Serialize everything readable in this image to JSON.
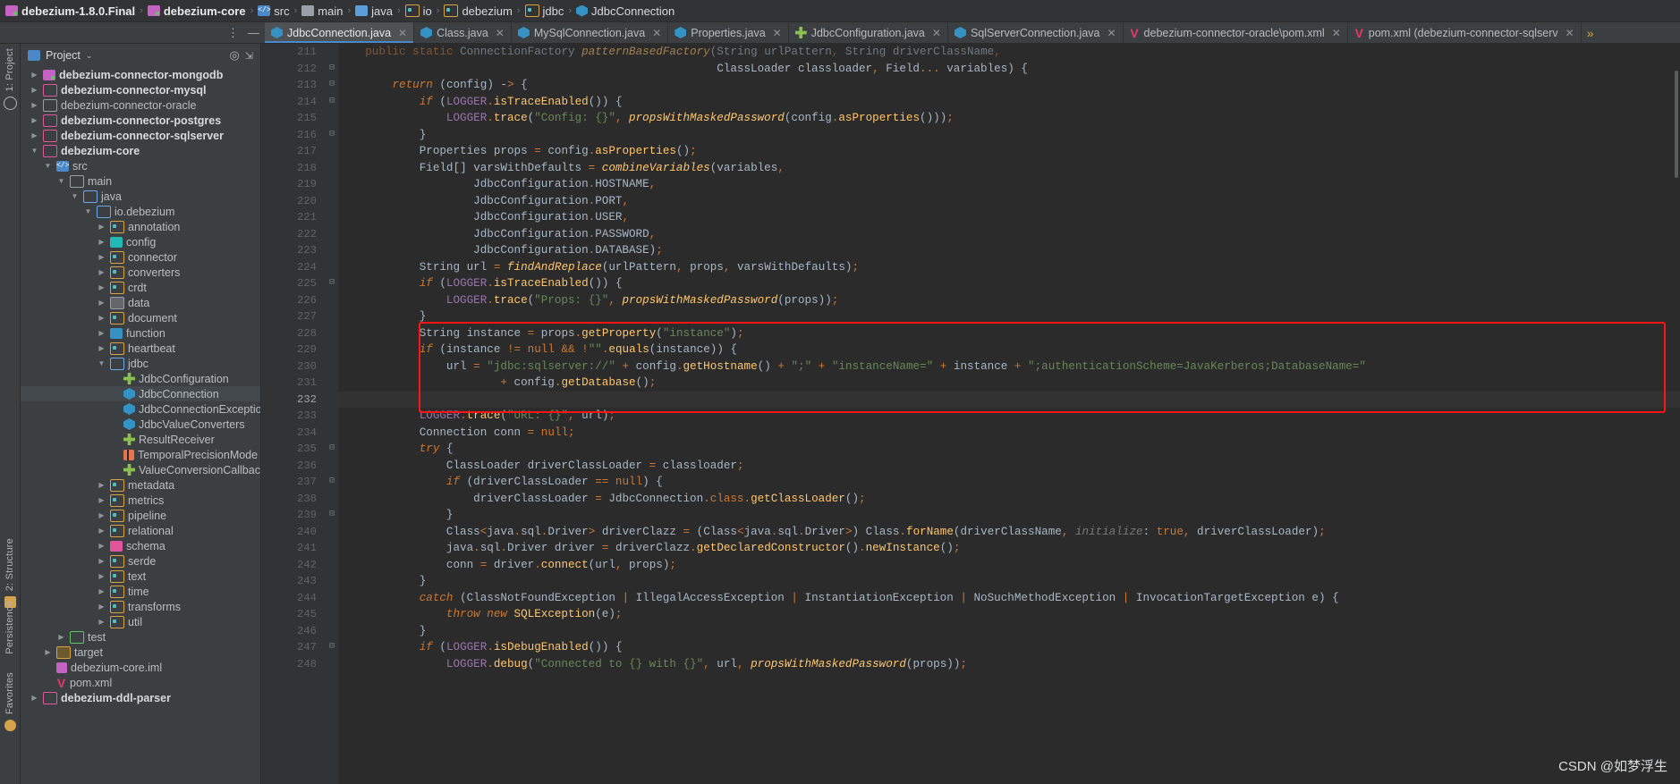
{
  "window": {
    "breadcrumb": [
      {
        "label": "debezium-1.8.0.Final",
        "icon": "module-icon",
        "bold": true
      },
      {
        "label": "debezium-core",
        "icon": "module-icon",
        "bold": true
      },
      {
        "label": "src",
        "icon": "source-root-icon",
        "bold": false
      },
      {
        "label": "main",
        "icon": "folder-grey-icon",
        "bold": false
      },
      {
        "label": "java",
        "icon": "folder-blue-icon",
        "bold": false
      },
      {
        "label": "io",
        "icon": "package-icon",
        "bold": false
      },
      {
        "label": "debezium",
        "icon": "package-icon",
        "bold": false
      },
      {
        "label": "jdbc",
        "icon": "package-icon",
        "bold": false
      },
      {
        "label": "JdbcConnection",
        "icon": "java-class-icon",
        "bold": false
      }
    ]
  },
  "tabs": {
    "items": [
      {
        "label": "JdbcConnection.java",
        "icon": "java-class-icon",
        "active": true,
        "closable": true
      },
      {
        "label": "Class.java",
        "icon": "java-class-icon",
        "active": false,
        "closable": true
      },
      {
        "label": "MySqlConnection.java",
        "icon": "java-class-icon",
        "active": false,
        "closable": true
      },
      {
        "label": "Properties.java",
        "icon": "java-class-icon",
        "active": false,
        "closable": true
      },
      {
        "label": "JdbcConfiguration.java",
        "icon": "java-interface-icon",
        "active": false,
        "closable": true
      },
      {
        "label": "SqlServerConnection.java",
        "icon": "java-class-icon",
        "active": false,
        "closable": true
      },
      {
        "label": "debezium-connector-oracle\\pom.xml",
        "icon": "maven-icon",
        "active": false,
        "closable": true
      },
      {
        "label": "pom.xml (debezium-connector-sqlserv",
        "icon": "maven-icon",
        "active": false,
        "closable": true
      }
    ],
    "overflow_label": "»",
    "menu_label": "⋮",
    "hide_label": "—"
  },
  "left_strip": {
    "items": [
      {
        "label": "1: Project",
        "icon": "project-icon"
      },
      {
        "label": "2: Structure",
        "icon": "structure-icon"
      },
      {
        "label": "Persistence",
        "icon": "persistence-icon"
      },
      {
        "label": "Favorites",
        "icon": "favorites-icon"
      }
    ]
  },
  "project_panel": {
    "title": "Project",
    "chevron": "⌄",
    "locate_icon": "target-icon",
    "collapse_icon": "collapse-all-icon",
    "tree": [
      {
        "label": "debezium-connector-mongodb",
        "depth": 1,
        "arrow": "collapsed",
        "icon": "module-icon",
        "bold": true,
        "selected": false
      },
      {
        "label": "debezium-connector-mysql",
        "depth": 1,
        "arrow": "collapsed",
        "icon": "folder-pink-icon",
        "bold": true,
        "selected": false
      },
      {
        "label": "debezium-connector-oracle",
        "depth": 1,
        "arrow": "collapsed",
        "icon": "folder-grey-icon",
        "bold": false,
        "selected": false
      },
      {
        "label": "debezium-connector-postgres",
        "depth": 1,
        "arrow": "collapsed",
        "icon": "folder-pink-icon",
        "bold": true,
        "selected": false
      },
      {
        "label": "debezium-connector-sqlserver",
        "depth": 1,
        "arrow": "collapsed",
        "icon": "folder-pink-icon",
        "bold": true,
        "selected": false
      },
      {
        "label": "debezium-core",
        "depth": 1,
        "arrow": "expanded",
        "icon": "folder-pink-icon",
        "bold": true,
        "selected": false
      },
      {
        "label": "src",
        "depth": 2,
        "arrow": "expanded",
        "icon": "source-root-icon",
        "bold": false,
        "selected": false
      },
      {
        "label": "main",
        "depth": 3,
        "arrow": "expanded",
        "icon": "folder-grey-icon",
        "bold": false,
        "selected": false
      },
      {
        "label": "java",
        "depth": 4,
        "arrow": "expanded",
        "icon": "folder-blue-icon",
        "bold": false,
        "selected": false
      },
      {
        "label": "io.debezium",
        "depth": 5,
        "arrow": "expanded",
        "icon": "folder-blue-icon",
        "bold": false,
        "selected": false
      },
      {
        "label": "annotation",
        "depth": 6,
        "arrow": "collapsed",
        "icon": "package-icon",
        "bold": false,
        "selected": false
      },
      {
        "label": "config",
        "depth": 6,
        "arrow": "collapsed",
        "icon": "package-config-icon",
        "bold": false,
        "selected": false
      },
      {
        "label": "connector",
        "depth": 6,
        "arrow": "collapsed",
        "icon": "package-icon",
        "bold": false,
        "selected": false
      },
      {
        "label": "converters",
        "depth": 6,
        "arrow": "collapsed",
        "icon": "package-icon",
        "bold": false,
        "selected": false
      },
      {
        "label": "crdt",
        "depth": 6,
        "arrow": "collapsed",
        "icon": "package-icon",
        "bold": false,
        "selected": false
      },
      {
        "label": "data",
        "depth": 6,
        "arrow": "collapsed",
        "icon": "package-grey-icon",
        "bold": false,
        "selected": false
      },
      {
        "label": "document",
        "depth": 6,
        "arrow": "collapsed",
        "icon": "package-icon",
        "bold": false,
        "selected": false
      },
      {
        "label": "function",
        "depth": 6,
        "arrow": "collapsed",
        "icon": "package-blue-icon",
        "bold": false,
        "selected": false
      },
      {
        "label": "heartbeat",
        "depth": 6,
        "arrow": "collapsed",
        "icon": "package-icon",
        "bold": false,
        "selected": false
      },
      {
        "label": "jdbc",
        "depth": 6,
        "arrow": "expanded",
        "icon": "folder-blue-icon",
        "bold": false,
        "selected": false
      },
      {
        "label": "JdbcConfiguration",
        "depth": 7,
        "arrow": "none",
        "icon": "java-interface-icon",
        "bold": false,
        "selected": false
      },
      {
        "label": "JdbcConnection",
        "depth": 7,
        "arrow": "none",
        "icon": "java-class-icon",
        "bold": false,
        "selected": true
      },
      {
        "label": "JdbcConnectionException",
        "depth": 7,
        "arrow": "none",
        "icon": "java-class-icon",
        "bold": false,
        "selected": false
      },
      {
        "label": "JdbcValueConverters",
        "depth": 7,
        "arrow": "none",
        "icon": "java-class-icon",
        "bold": false,
        "selected": false
      },
      {
        "label": "ResultReceiver",
        "depth": 7,
        "arrow": "none",
        "icon": "java-interface-icon",
        "bold": false,
        "selected": false
      },
      {
        "label": "TemporalPrecisionMode",
        "depth": 7,
        "arrow": "none",
        "icon": "java-enum-icon",
        "bold": false,
        "selected": false
      },
      {
        "label": "ValueConversionCallback",
        "depth": 7,
        "arrow": "none",
        "icon": "java-interface-icon",
        "bold": false,
        "selected": false
      },
      {
        "label": "metadata",
        "depth": 6,
        "arrow": "collapsed",
        "icon": "package-icon",
        "bold": false,
        "selected": false
      },
      {
        "label": "metrics",
        "depth": 6,
        "arrow": "collapsed",
        "icon": "package-icon",
        "bold": false,
        "selected": false
      },
      {
        "label": "pipeline",
        "depth": 6,
        "arrow": "collapsed",
        "icon": "package-icon",
        "bold": false,
        "selected": false
      },
      {
        "label": "relational",
        "depth": 6,
        "arrow": "collapsed",
        "icon": "package-icon",
        "bold": false,
        "selected": false
      },
      {
        "label": "schema",
        "depth": 6,
        "arrow": "collapsed",
        "icon": "package-pink-icon",
        "bold": false,
        "selected": false
      },
      {
        "label": "serde",
        "depth": 6,
        "arrow": "collapsed",
        "icon": "package-icon",
        "bold": false,
        "selected": false
      },
      {
        "label": "text",
        "depth": 6,
        "arrow": "collapsed",
        "icon": "package-icon",
        "bold": false,
        "selected": false
      },
      {
        "label": "time",
        "depth": 6,
        "arrow": "collapsed",
        "icon": "package-icon",
        "bold": false,
        "selected": false
      },
      {
        "label": "transforms",
        "depth": 6,
        "arrow": "collapsed",
        "icon": "package-icon",
        "bold": false,
        "selected": false
      },
      {
        "label": "util",
        "depth": 6,
        "arrow": "collapsed",
        "icon": "package-icon",
        "bold": false,
        "selected": false
      },
      {
        "label": "test",
        "depth": 3,
        "arrow": "collapsed",
        "icon": "folder-green-icon",
        "bold": false,
        "selected": false
      },
      {
        "label": "target",
        "depth": 2,
        "arrow": "collapsed",
        "icon": "folder-orange-icon",
        "bold": false,
        "selected": false
      },
      {
        "label": "debezium-core.iml",
        "depth": 2,
        "arrow": "none",
        "icon": "iml-icon",
        "bold": false,
        "selected": false
      },
      {
        "label": "pom.xml",
        "depth": 2,
        "arrow": "none",
        "icon": "maven-icon",
        "bold": false,
        "selected": false
      },
      {
        "label": "debezium-ddl-parser",
        "depth": 1,
        "arrow": "collapsed",
        "icon": "folder-pink-icon",
        "bold": true,
        "selected": false
      }
    ]
  },
  "editor": {
    "filename": "JdbcConnection.java",
    "first_line_number": 211,
    "caret_line_number": 232,
    "highlight_box": {
      "color": "#ff1414",
      "from_line": 228,
      "to_line": 232
    },
    "lines": [
      {
        "n": 211,
        "fold": "",
        "partial": true,
        "text": "    public static ConnectionFactory patternBasedFactory(String urlPattern, String driverClassName,"
      },
      {
        "n": 212,
        "fold": "minus",
        "text": "                                                        ClassLoader classloader, Field... variables) {"
      },
      {
        "n": 213,
        "fold": "minus",
        "text": "        return (config) -> {"
      },
      {
        "n": 214,
        "fold": "minus",
        "text": "            if (LOGGER.isTraceEnabled()) {"
      },
      {
        "n": 215,
        "fold": "",
        "text": "                LOGGER.trace(\"Config: {}\", propsWithMaskedPassword(config.asProperties()));"
      },
      {
        "n": 216,
        "fold": "minus",
        "text": "            }"
      },
      {
        "n": 217,
        "fold": "",
        "text": "            Properties props = config.asProperties();"
      },
      {
        "n": 218,
        "fold": "",
        "text": "            Field[] varsWithDefaults = combineVariables(variables,"
      },
      {
        "n": 219,
        "fold": "",
        "text": "                    JdbcConfiguration.HOSTNAME,"
      },
      {
        "n": 220,
        "fold": "",
        "text": "                    JdbcConfiguration.PORT,"
      },
      {
        "n": 221,
        "fold": "",
        "text": "                    JdbcConfiguration.USER,"
      },
      {
        "n": 222,
        "fold": "",
        "text": "                    JdbcConfiguration.PASSWORD,"
      },
      {
        "n": 223,
        "fold": "",
        "text": "                    JdbcConfiguration.DATABASE);"
      },
      {
        "n": 224,
        "fold": "",
        "text": "            String url = findAndReplace(urlPattern, props, varsWithDefaults);"
      },
      {
        "n": 225,
        "fold": "minus",
        "text": "            if (LOGGER.isTraceEnabled()) {"
      },
      {
        "n": 226,
        "fold": "",
        "text": "                LOGGER.trace(\"Props: {}\", propsWithMaskedPassword(props));"
      },
      {
        "n": 227,
        "fold": "",
        "text": "            }"
      },
      {
        "n": 228,
        "fold": "",
        "text": "            String instance = props.getProperty(\"instance\");"
      },
      {
        "n": 229,
        "fold": "",
        "text": "            if (instance != null && !\"\".equals(instance)) {"
      },
      {
        "n": 230,
        "fold": "",
        "text": "                url = \"jdbc:sqlserver://\" + config.getHostname() + \";\" + \"instanceName=\" + instance + \";authenticationScheme=JavaKerberos;DatabaseName=\""
      },
      {
        "n": 231,
        "fold": "",
        "text": "                        + config.getDatabase();"
      },
      {
        "n": 232,
        "fold": "",
        "text": "            "
      },
      {
        "n": 233,
        "fold": "",
        "text": "            LOGGER.trace(\"URL: {}\", url);"
      },
      {
        "n": 234,
        "fold": "",
        "text": "            Connection conn = null;"
      },
      {
        "n": 235,
        "fold": "minus",
        "text": "            try {"
      },
      {
        "n": 236,
        "fold": "",
        "text": "                ClassLoader driverClassLoader = classloader;"
      },
      {
        "n": 237,
        "fold": "minus",
        "text": "                if (driverClassLoader == null) {"
      },
      {
        "n": 238,
        "fold": "",
        "text": "                    driverClassLoader = JdbcConnection.class.getClassLoader();"
      },
      {
        "n": 239,
        "fold": "minus",
        "text": "                }"
      },
      {
        "n": 240,
        "fold": "",
        "text": "                Class<java.sql.Driver> driverClazz = (Class<java.sql.Driver>) Class.forName(driverClassName, initialize: true, driverClassLoader);"
      },
      {
        "n": 241,
        "fold": "",
        "text": "                java.sql.Driver driver = driverClazz.getDeclaredConstructor().newInstance();"
      },
      {
        "n": 242,
        "fold": "",
        "text": "                conn = driver.connect(url, props);"
      },
      {
        "n": 243,
        "fold": "",
        "text": "            }"
      },
      {
        "n": 244,
        "fold": "",
        "text": "            catch (ClassNotFoundException | IllegalAccessException | InstantiationException | NoSuchMethodException | InvocationTargetException e) {"
      },
      {
        "n": 245,
        "fold": "",
        "text": "                throw new SQLException(e);"
      },
      {
        "n": 246,
        "fold": "",
        "text": "            }"
      },
      {
        "n": 247,
        "fold": "minus",
        "text": "            if (LOGGER.isDebugEnabled()) {"
      },
      {
        "n": 248,
        "fold": "",
        "text": "                LOGGER.debug(\"Connected to {} with {}\", url, propsWithMaskedPassword(props));"
      }
    ]
  },
  "watermark": {
    "text": "CSDN @如梦浮生"
  },
  "colors": {
    "accent": "#4a88c7",
    "highlight_box": "#ff1414",
    "editor_bg": "#2b2b2b",
    "panel_bg": "#3c3f41",
    "gutter_bg": "#313335",
    "string": "#6a8759",
    "keyword": "#cc7832",
    "method": "#ffc66d",
    "field": "#9876aa",
    "number": "#6897bb"
  }
}
